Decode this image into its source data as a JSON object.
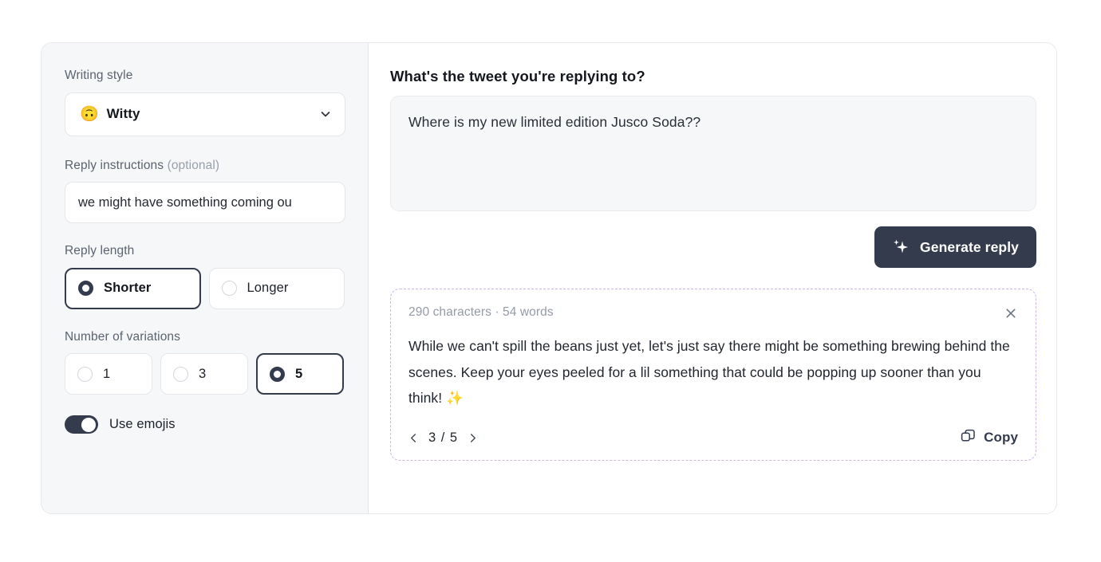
{
  "sidebar": {
    "writing_style": {
      "label": "Writing style",
      "emoji": "🙃",
      "value": "Witty",
      "chevron_icon": "chevron-down-icon"
    },
    "reply_instructions": {
      "label": "Reply instructions",
      "label_suffix": "(optional)",
      "value": "we might have something coming ou",
      "placeholder": "Reply instructions"
    },
    "reply_length": {
      "label": "Reply length",
      "options": [
        {
          "label": "Shorter",
          "selected": true
        },
        {
          "label": "Longer",
          "selected": false
        }
      ]
    },
    "variations": {
      "label": "Number of variations",
      "options": [
        {
          "label": "1",
          "selected": false
        },
        {
          "label": "3",
          "selected": false
        },
        {
          "label": "5",
          "selected": true
        }
      ]
    },
    "use_emojis": {
      "label": "Use emojis",
      "enabled": true
    }
  },
  "main": {
    "title": "What's the tweet you're replying to?",
    "tweet": {
      "value": "Where is my new limited edition Jusco Soda??",
      "placeholder": "Paste the tweet you're replying to"
    },
    "generate_button": {
      "label": "Generate reply",
      "icon": "sparkle-icon"
    },
    "result": {
      "meta": "290 characters · 54 words",
      "close_icon": "close-icon",
      "text": "While we can't spill the beans just yet, let's just say there might be something brewing behind the scenes. Keep your eyes peeled for a lil something that could be popping up sooner than you think! ✨",
      "pager": {
        "prev_icon": "chevron-left-icon",
        "next_icon": "chevron-right-icon",
        "count": "3 / 5",
        "current": 3,
        "total": 5
      },
      "copy_button": {
        "label": "Copy",
        "icon": "copy-icon"
      }
    }
  },
  "colors": {
    "accent_dark": "#343b4c",
    "panel_bg": "#f6f7f8",
    "result_border": "#cbb5ea",
    "muted_text": "#949ba6"
  }
}
